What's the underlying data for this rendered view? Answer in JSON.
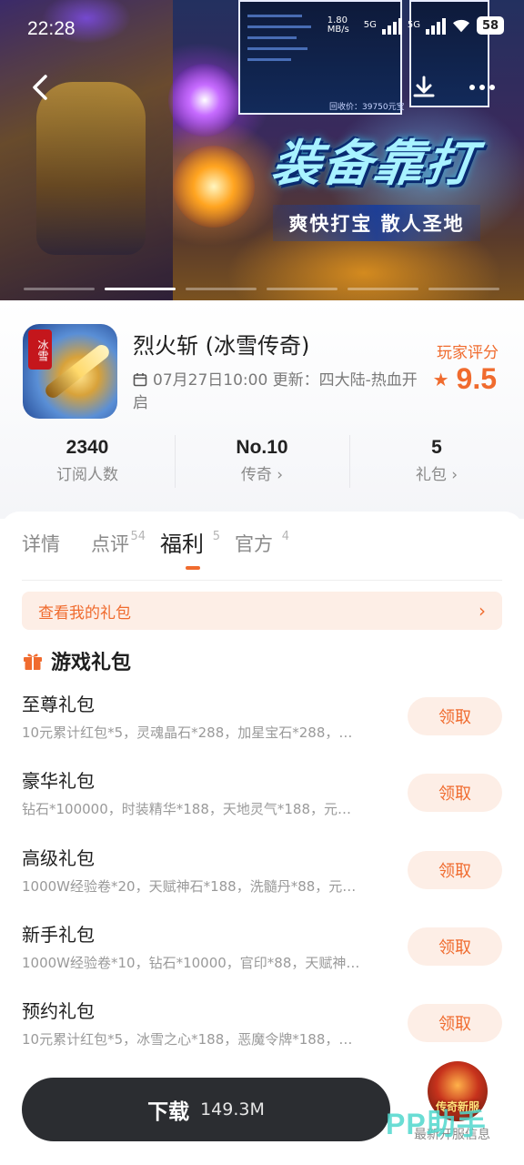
{
  "status_bar": {
    "time": "22:28",
    "net_speed": "1.80 MB/s",
    "net_type_1": "5G",
    "net_type_2": "5G",
    "battery": "58"
  },
  "banner": {
    "slogan_main": "装备靠打",
    "slogan_sub": "爽快打宝 散人圣地",
    "screenshot_caption": "回收价：39750元宝",
    "slides_total": 6,
    "active_slide": 2
  },
  "game": {
    "title": "烈火斩 (冰雪传奇)",
    "icon_tag": "冰雪",
    "update_text": "07月27日10:00 更新：四大陆-热血开启",
    "rating_label": "玩家评分",
    "rating_value": "9.5"
  },
  "stats": [
    {
      "value": "2340",
      "label": "订阅人数"
    },
    {
      "value": "No.10",
      "label": "传奇 ›"
    },
    {
      "value": "5",
      "label": "礼包 ›"
    }
  ],
  "tabs": [
    {
      "label": "详情",
      "count": ""
    },
    {
      "label": "点评",
      "count": "54"
    },
    {
      "label": "福利",
      "count": "5"
    },
    {
      "label": "官方",
      "count": "4"
    }
  ],
  "my_gifts": {
    "label": "查看我的礼包",
    "chevron": "›"
  },
  "section_title": "游戏礼包",
  "gifts": [
    {
      "name": "至尊礼包",
      "desc": "10元累计红包*5，灵魂晶石*288，加星宝石*288，…",
      "button": "领取"
    },
    {
      "name": "豪华礼包",
      "desc": "钻石*100000，时装精华*188，天地灵气*188，元…",
      "button": "领取"
    },
    {
      "name": "高级礼包",
      "desc": "1000W经验卷*20，天赋神石*188，洗髓丹*88，元…",
      "button": "领取"
    },
    {
      "name": "新手礼包",
      "desc": "1000W经验卷*10，钻石*10000，官印*88，天赋神…",
      "button": "领取"
    },
    {
      "name": "预约礼包",
      "desc": "10元累计红包*5，冰雪之心*188，恶魔令牌*188，…",
      "button": "领取"
    }
  ],
  "download": {
    "label": "下载",
    "size": "149.3M"
  },
  "news": {
    "badge": "传奇新服",
    "label": "最新开服信息"
  },
  "watermark": "PP助手",
  "colors": {
    "accent": "#f06b2e",
    "accent_bg": "#fdeee6",
    "download_bg": "#2b2d31"
  }
}
